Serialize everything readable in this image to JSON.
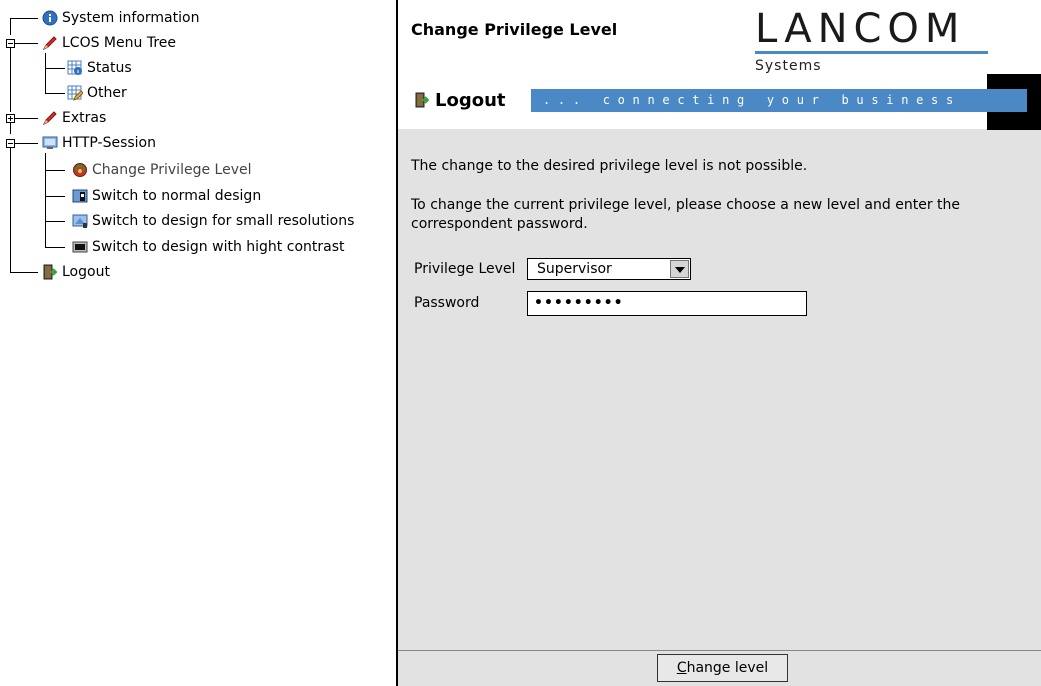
{
  "tree": {
    "items": [
      {
        "label": "System information"
      },
      {
        "label": "LCOS Menu Tree"
      },
      {
        "label": "Status"
      },
      {
        "label": "Other"
      },
      {
        "label": "Extras"
      },
      {
        "label": "HTTP-Session"
      },
      {
        "label": "Change Privilege Level"
      },
      {
        "label": "Switch to normal design"
      },
      {
        "label": "Switch to design for small resolutions"
      },
      {
        "label": "Switch to design with hight contrast"
      },
      {
        "label": "Logout"
      }
    ]
  },
  "header": {
    "page_title": "Change Privilege Level",
    "logo_name": "LANCOM",
    "logo_sub": "Systems",
    "logout_label": "Logout",
    "slogan": "... connecting your business",
    "accent_color": "#4a88c6"
  },
  "form": {
    "message": "The change to the desired privilege level is not possible.",
    "instructions": "To change the current privilege level, please choose a new level and enter the correspondent password.",
    "privilege_label": "Privilege Level",
    "privilege_value": "Supervisor",
    "password_label": "Password",
    "password_value": "•••••••••"
  },
  "footer": {
    "button_first": "C",
    "button_rest": "hange level"
  }
}
